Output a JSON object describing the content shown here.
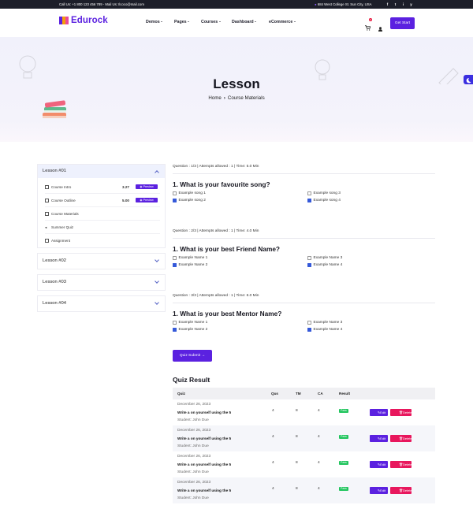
{
  "topbar": {
    "contact": "Call Us: +1 800 123 456 789 - Mail Us: Ilcoco@mail.com",
    "address": "684 West College St. Sun City, USA",
    "social": [
      "f",
      "t",
      "i",
      "y"
    ]
  },
  "brand": {
    "name": "Edurock",
    "accent": "#5b21e0"
  },
  "nav": {
    "items": [
      {
        "label": "Demos"
      },
      {
        "label": "Pages"
      },
      {
        "label": "Courses"
      },
      {
        "label": "Dashboard"
      },
      {
        "label": "eCommerce"
      }
    ],
    "cart_count": "0",
    "cta": "Get Start"
  },
  "hero": {
    "title": "Lesson",
    "crumb_home": "Home",
    "crumb_current": "Course Materials"
  },
  "sidebar": {
    "lessons": [
      {
        "title": "Lesson #01",
        "items": [
          {
            "label": "Course Intro",
            "duration": "3.27",
            "preview": "Preview"
          },
          {
            "label": "Course Outline",
            "duration": "5.00",
            "preview": "Preview"
          },
          {
            "label": "Course Materials",
            "duration": "",
            "preview": ""
          },
          {
            "label": "Summer Quiz",
            "duration": "",
            "preview": ""
          },
          {
            "label": "Assignment",
            "duration": "",
            "preview": ""
          }
        ]
      },
      {
        "title": "Lesson #02"
      },
      {
        "title": "Lesson #03"
      },
      {
        "title": "Lesson #04"
      }
    ]
  },
  "quizzes": [
    {
      "meta": "Question : 1/3 | Attempts allowed : 1 | Time: 5.0 Min",
      "title": "1. What is your favourite song?",
      "options": [
        {
          "label": "Example song 1",
          "checked": false
        },
        {
          "label": "Example song 3",
          "checked": false
        },
        {
          "label": "Example song 2",
          "checked": true
        },
        {
          "label": "Example song 4",
          "checked": true
        }
      ]
    },
    {
      "meta": "Question : 2/3 | Attempts allowed : 1 | Time: 4.0 Min",
      "title": "1. What is your best Friend Name?",
      "options": [
        {
          "label": "Example Name 1",
          "checked": false
        },
        {
          "label": "Example Name 3",
          "checked": false
        },
        {
          "label": "Example Name 2",
          "checked": true
        },
        {
          "label": "Example Name 4",
          "checked": true
        }
      ]
    },
    {
      "meta": "Question : 3/3 | Attempts allowed : 1 | Time: 6.0 Min",
      "title": "1. What is your best Mentor Name?",
      "options": [
        {
          "label": "Example Name 1",
          "checked": false
        },
        {
          "label": "Example Name 3",
          "checked": false
        },
        {
          "label": "Example Name 2",
          "checked": true
        },
        {
          "label": "Example Name 4",
          "checked": true
        }
      ]
    }
  ],
  "submit_label": "Quiz Submit →",
  "result": {
    "title": "Quiz Result",
    "columns": [
      "Quiz",
      "Qus",
      "TM",
      "CA",
      "Result"
    ],
    "rows": [
      {
        "date": "December 26, 2023",
        "title": "Write a on yourself using the 5",
        "student": "Student: John Due",
        "qus": "4",
        "tm": "8",
        "ca": "4",
        "result": "Pass",
        "edit": "Edit",
        "delete": "Delete"
      },
      {
        "date": "December 26, 2023",
        "title": "Write a on yourself using the 5",
        "student": "Student: John Due",
        "qus": "4",
        "tm": "8",
        "ca": "4",
        "result": "Pass",
        "edit": "Edit",
        "delete": "Delete"
      },
      {
        "date": "December 26, 2023",
        "title": "Write a on yourself using the 5",
        "student": "Student: John Due",
        "qus": "4",
        "tm": "8",
        "ca": "4",
        "result": "Pass",
        "edit": "Edit",
        "delete": "Delete"
      },
      {
        "date": "December 26, 2023",
        "title": "Write a on yourself using the 5",
        "student": "Student: John Due",
        "qus": "4",
        "tm": "8",
        "ca": "4",
        "result": "Pass",
        "edit": "Edit",
        "delete": "Delete"
      }
    ]
  }
}
